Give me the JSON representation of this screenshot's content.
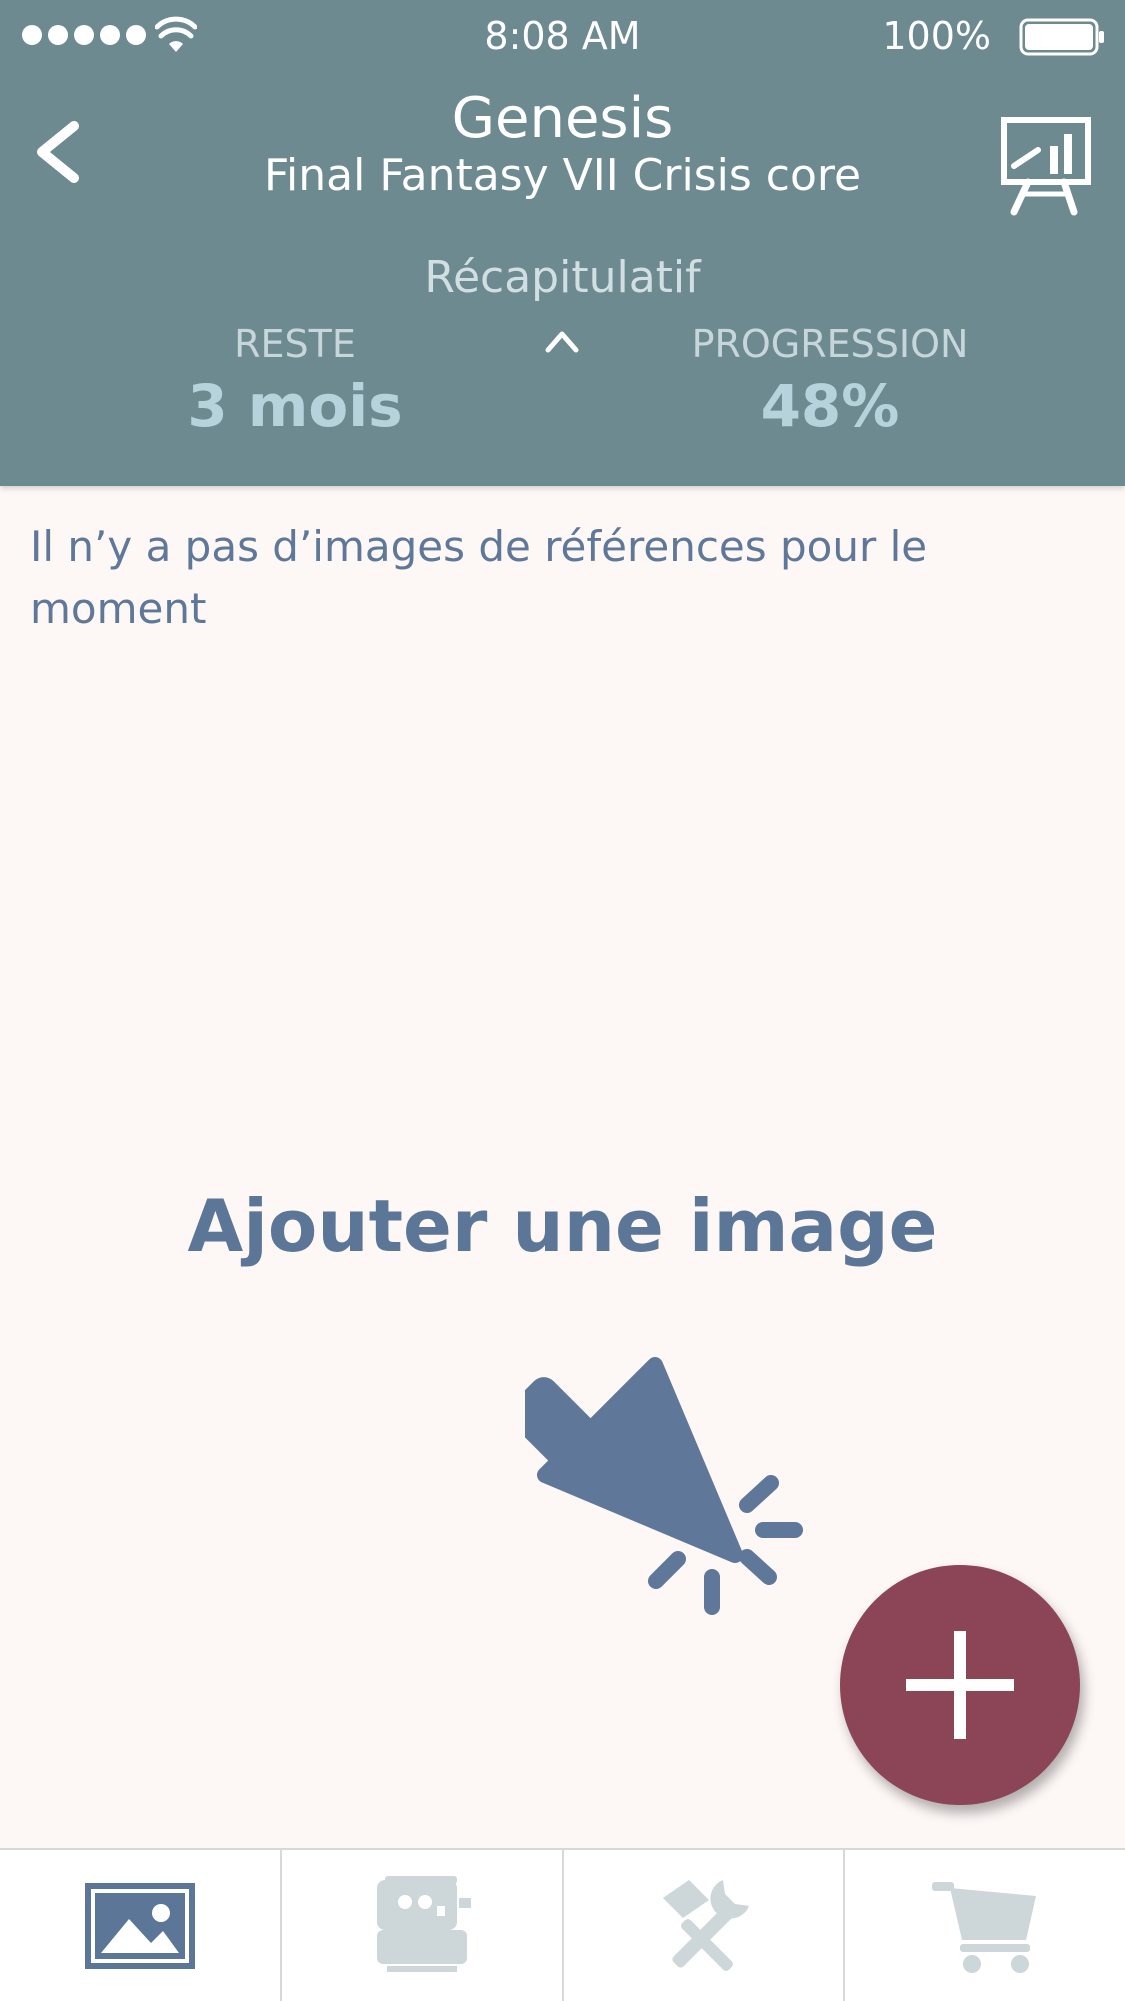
{
  "status_bar": {
    "time": "8:08 AM",
    "battery": "100%",
    "icons": [
      "signal-dots-icon",
      "wifi-icon",
      "battery-icon"
    ]
  },
  "header": {
    "title": "Genesis",
    "subtitle": "Final Fantasy VII Crisis core",
    "back_icon": "chevron-left-icon",
    "action_icon": "presentation-chart-icon",
    "summary_label": "Récapitulatif",
    "remaining_label": "RESTE",
    "remaining_value": "3 mois",
    "progress_label": "PROGRESSION",
    "progress_value": "48%",
    "collapse_icon": "chevron-up-icon"
  },
  "content": {
    "empty_message": "Il n’y a pas d’images de références pour le moment",
    "add_image_label": "Ajouter une image",
    "pointer_icon": "click-pointer-icon"
  },
  "fab": {
    "icon": "plus-icon"
  },
  "tab_bar": {
    "tabs": [
      {
        "name": "images",
        "icon": "image-icon",
        "active": true
      },
      {
        "name": "sewing",
        "icon": "sewing-machine-icon",
        "active": false
      },
      {
        "name": "tools",
        "icon": "tools-icon",
        "active": false
      },
      {
        "name": "cart",
        "icon": "shopping-cart-icon",
        "active": false
      }
    ]
  },
  "colors": {
    "header_bg": "#6c8a90",
    "page_bg": "#fdf7f6",
    "text_accent": "#5b7697",
    "fab": "#8b4557",
    "tab_active": "#5b7697",
    "tab_inactive": "#cdd6d8"
  }
}
